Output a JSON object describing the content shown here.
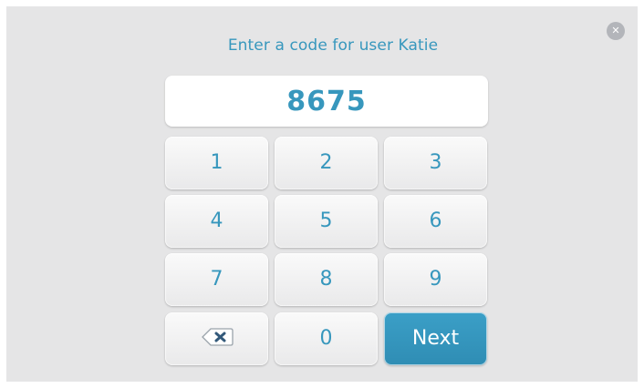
{
  "prompt": "Enter a code for user Katie",
  "code_value": "8675",
  "close_icon": "close-icon",
  "keypad": {
    "k1": "1",
    "k2": "2",
    "k3": "3",
    "k4": "4",
    "k5": "5",
    "k6": "6",
    "k7": "7",
    "k8": "8",
    "k9": "9",
    "k0": "0",
    "backspace_icon": "backspace-icon",
    "next_label": "Next"
  },
  "colors": {
    "accent": "#3797bd",
    "background": "#e5e5e6",
    "next_button": "#3397bf"
  }
}
